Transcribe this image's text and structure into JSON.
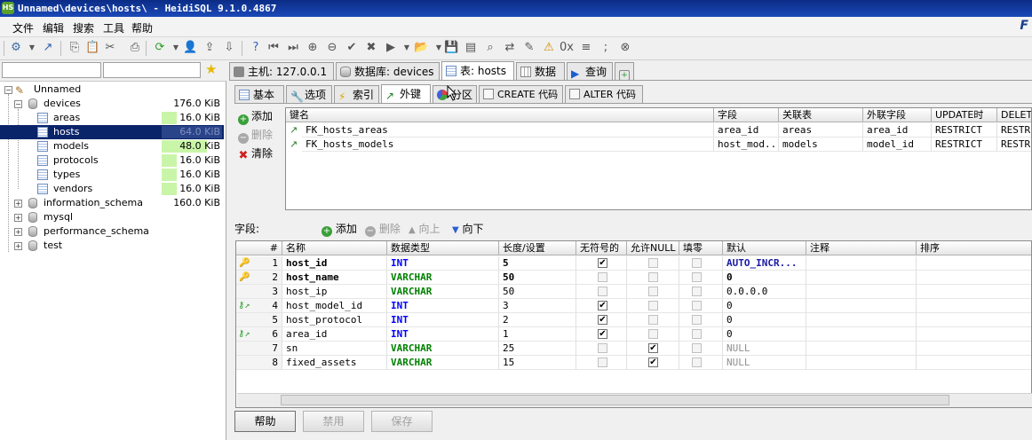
{
  "window": {
    "title": "Unnamed\\devices\\hosts\\ - HeidiSQL 9.1.0.4867"
  },
  "menu": [
    "文件",
    "编辑",
    "搜索",
    "工具",
    "帮助"
  ],
  "tree": {
    "root": "Unnamed",
    "items": [
      {
        "label": "devices",
        "size": "176.0 KiB",
        "fill": 0
      },
      {
        "label": "areas",
        "size": "16.0 KiB",
        "fill": 0.25
      },
      {
        "label": "hosts",
        "size": "64.0 KiB",
        "fill": 1.0
      },
      {
        "label": "models",
        "size": "48.0 KiB",
        "fill": 0.75
      },
      {
        "label": "protocols",
        "size": "16.0 KiB",
        "fill": 0.25
      },
      {
        "label": "types",
        "size": "16.0 KiB",
        "fill": 0.25
      },
      {
        "label": "vendors",
        "size": "16.0 KiB",
        "fill": 0.25
      },
      {
        "label": "information_schema",
        "size": "160.0 KiB",
        "fill": 0
      },
      {
        "label": "mysql",
        "size": "",
        "fill": 0
      },
      {
        "label": "performance_schema",
        "size": "",
        "fill": 0
      },
      {
        "label": "test",
        "size": "",
        "fill": 0
      }
    ],
    "selected": "hosts"
  },
  "main_tabs": [
    "主机: 127.0.0.1",
    "数据库: devices",
    "表: hosts",
    "数据",
    "查询"
  ],
  "sub_tabs": [
    "基本",
    "选项",
    "索引",
    "外键",
    "分区",
    "CREATE 代码",
    "ALTER 代码"
  ],
  "fk": {
    "buttons": {
      "add": "添加",
      "remove": "删除",
      "clear": "清除"
    },
    "headers": [
      "键名",
      "字段",
      "关联表",
      "外联字段",
      "UPDATE时",
      "DELETE"
    ],
    "rows": [
      [
        "FK_hosts_areas",
        "area_id",
        "areas",
        "area_id",
        "RESTRICT",
        "RESTRICT"
      ],
      [
        "FK_hosts_models",
        "host_mod...",
        "models",
        "model_id",
        "RESTRICT",
        "RESTRICT"
      ]
    ]
  },
  "fields_bar": {
    "label": "字段:",
    "add": "添加",
    "remove": "删除",
    "up": "向上",
    "down": "向下"
  },
  "columns": {
    "headers": [
      "#",
      "名称",
      "数据类型",
      "长度/设置",
      "无符号的",
      "允许NULL",
      "填零",
      "默认",
      "注释",
      "排序"
    ],
    "rows": [
      {
        "num": "1",
        "name": "host_id",
        "type": "INT",
        "len": "5",
        "unsigned": true,
        "allow_null": false,
        "zerofill": false,
        "default": "AUTO_INCR...",
        "key": "primary"
      },
      {
        "num": "2",
        "name": "host_name",
        "type": "VARCHAR",
        "len": "50",
        "unsigned": false,
        "allow_null": false,
        "zerofill": false,
        "default": "0",
        "key": "unique"
      },
      {
        "num": "3",
        "name": "host_ip",
        "type": "VARCHAR",
        "len": "50",
        "unsigned": false,
        "allow_null": false,
        "zerofill": false,
        "default": "0.0.0.0",
        "key": ""
      },
      {
        "num": "4",
        "name": "host_model_id",
        "type": "INT",
        "len": "3",
        "unsigned": true,
        "allow_null": false,
        "zerofill": false,
        "default": "0",
        "key": "foreign"
      },
      {
        "num": "5",
        "name": "host_protocol",
        "type": "INT",
        "len": "2",
        "unsigned": true,
        "allow_null": false,
        "zerofill": false,
        "default": "0",
        "key": ""
      },
      {
        "num": "6",
        "name": "area_id",
        "type": "INT",
        "len": "1",
        "unsigned": true,
        "allow_null": false,
        "zerofill": false,
        "default": "0",
        "key": "foreign"
      },
      {
        "num": "7",
        "name": "sn",
        "type": "VARCHAR",
        "len": "25",
        "unsigned": false,
        "allow_null": true,
        "zerofill": false,
        "default": "NULL",
        "key": ""
      },
      {
        "num": "8",
        "name": "fixed_assets",
        "type": "VARCHAR",
        "len": "15",
        "unsigned": false,
        "allow_null": true,
        "zerofill": false,
        "default": "NULL",
        "key": ""
      }
    ]
  },
  "bottom_buttons": {
    "help": "帮助",
    "discard": "禁用",
    "save": "保存"
  },
  "colors": {
    "title_bar": "#1b49b8",
    "selection": "#0a246a",
    "size_bar": "#c9f5a8",
    "int_type": "#0000ff",
    "varchar_type": "#008000"
  }
}
